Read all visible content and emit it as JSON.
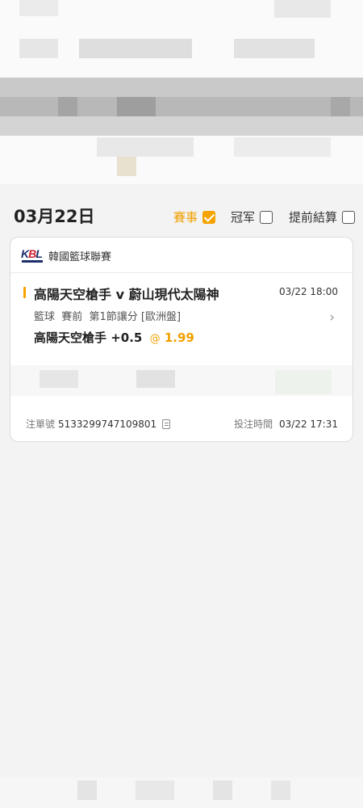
{
  "header": {
    "date": "03月22日"
  },
  "filters": [
    {
      "label": "賽事",
      "checked": true
    },
    {
      "label": "冠军",
      "checked": false
    },
    {
      "label": "提前結算",
      "checked": false
    }
  ],
  "bet": {
    "league": {
      "logo_text": "KBL",
      "name": "韓國籃球聯賽"
    },
    "match": "高陽天空槍手 v 蔚山現代太陽神",
    "kickoff": "03/22 18:00",
    "market": "籃球  賽前  第1節讓分 [歐洲盤]",
    "selection": "高陽天空槍手 +0.5",
    "odds_prefix": "@",
    "odds": "1.99",
    "order_label": "注單號",
    "order_number": "5133299747109801",
    "placed_label": "投注時間",
    "placed_time": "03/22 17:31"
  },
  "colors": {
    "accent": "#f5a300",
    "background": "#f3f3f4",
    "card": "#ffffff"
  },
  "icons": {
    "copy": "copy-icon",
    "chevron": "chevron-right-icon",
    "check": "checkmark-icon"
  }
}
